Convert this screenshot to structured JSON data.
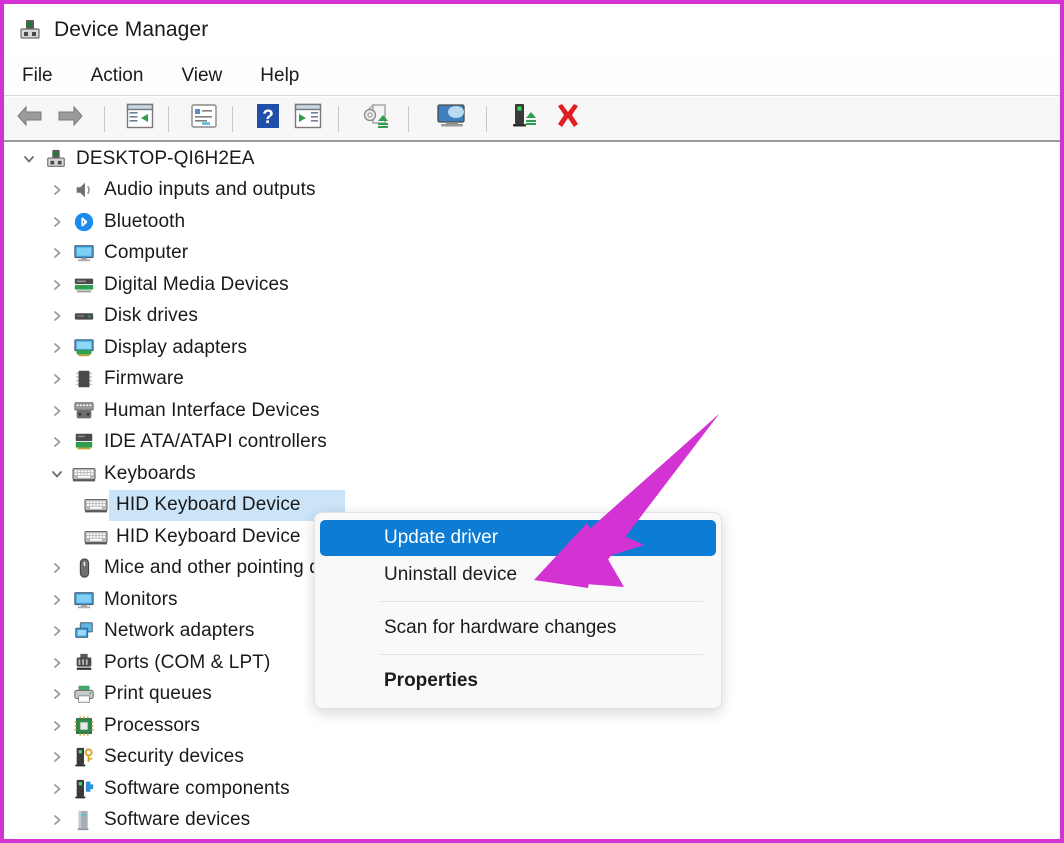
{
  "window": {
    "title": "Device Manager",
    "app_icon": "device-manager-icon",
    "border_color": "#d233d2"
  },
  "menubar": {
    "items": [
      {
        "label": "File"
      },
      {
        "label": "Action"
      },
      {
        "label": "View"
      },
      {
        "label": "Help"
      }
    ]
  },
  "toolbar": {
    "buttons": [
      {
        "icon": "back-arrow-icon",
        "name": "back-button"
      },
      {
        "icon": "forward-arrow-icon",
        "name": "forward-button"
      },
      {
        "icon": "show-hide-console-tree-icon",
        "name": "show-hide-console-tree-button"
      },
      {
        "icon": "properties-icon",
        "name": "properties-button"
      },
      {
        "icon": "help-icon",
        "name": "help-button"
      },
      {
        "icon": "show-hide-action-pane-icon",
        "name": "show-hide-action-pane-button"
      },
      {
        "icon": "update-driver-icon",
        "name": "update-driver-button"
      },
      {
        "icon": "scan-for-hardware-changes-icon",
        "name": "scan-for-hardware-changes-button"
      },
      {
        "icon": "disable-device-icon",
        "name": "disable-device-button"
      },
      {
        "icon": "uninstall-device-icon",
        "name": "uninstall-device-button"
      }
    ]
  },
  "tree": {
    "root": {
      "label": "DESKTOP-QI6H2EA",
      "icon": "computer-root-icon",
      "expanded": true
    },
    "nodes": [
      {
        "label": "Audio inputs and outputs",
        "icon": "speaker-icon",
        "depth": 1,
        "expanded": false
      },
      {
        "label": "Bluetooth",
        "icon": "bluetooth-icon",
        "depth": 1,
        "expanded": false
      },
      {
        "label": "Computer",
        "icon": "monitor-icon",
        "depth": 1,
        "expanded": false
      },
      {
        "label": "Digital Media Devices",
        "icon": "media-device-icon",
        "depth": 1,
        "expanded": false
      },
      {
        "label": "Disk drives",
        "icon": "disk-drive-icon",
        "depth": 1,
        "expanded": false
      },
      {
        "label": "Display adapters",
        "icon": "display-adapter-icon",
        "depth": 1,
        "expanded": false
      },
      {
        "label": "Firmware",
        "icon": "firmware-chip-icon",
        "depth": 1,
        "expanded": false
      },
      {
        "label": "Human Interface Devices",
        "icon": "hid-icon",
        "depth": 1,
        "expanded": false
      },
      {
        "label": "IDE ATA/ATAPI controllers",
        "icon": "ide-controller-icon",
        "depth": 1,
        "expanded": false
      },
      {
        "label": "Keyboards",
        "icon": "keyboard-icon",
        "depth": 1,
        "expanded": true
      },
      {
        "label": "HID Keyboard Device",
        "icon": "keyboard-icon",
        "depth": 2,
        "selected": true
      },
      {
        "label": "HID Keyboard Device",
        "icon": "keyboard-icon",
        "depth": 2,
        "selected": false
      },
      {
        "label": "Mice and other pointing devices",
        "icon": "mouse-icon",
        "depth": 1,
        "expanded": false
      },
      {
        "label": "Monitors",
        "icon": "monitor-icon",
        "depth": 1,
        "expanded": false
      },
      {
        "label": "Network adapters",
        "icon": "network-adapter-icon",
        "depth": 1,
        "expanded": false
      },
      {
        "label": "Ports (COM & LPT)",
        "icon": "port-icon",
        "depth": 1,
        "expanded": false
      },
      {
        "label": "Print queues",
        "icon": "printer-icon",
        "depth": 1,
        "expanded": false
      },
      {
        "label": "Processors",
        "icon": "processor-icon",
        "depth": 1,
        "expanded": false
      },
      {
        "label": "Security devices",
        "icon": "security-device-icon",
        "depth": 1,
        "expanded": false
      },
      {
        "label": "Software components",
        "icon": "software-component-icon",
        "depth": 1,
        "expanded": false
      },
      {
        "label": "Software devices",
        "icon": "software-device-icon",
        "depth": 1,
        "expanded": false
      }
    ]
  },
  "context_menu": {
    "highlight_color": "#0c7cd5",
    "items": [
      {
        "label": "Update driver",
        "highlighted": true,
        "bold": false
      },
      {
        "label": "Uninstall device",
        "highlighted": false,
        "bold": false
      },
      {
        "label": "Scan for hardware changes",
        "highlighted": false,
        "bold": false
      },
      {
        "label": "Properties",
        "highlighted": false,
        "bold": true
      }
    ]
  },
  "annotation": {
    "arrow_color": "#d233d2",
    "points_to": "Uninstall device"
  }
}
